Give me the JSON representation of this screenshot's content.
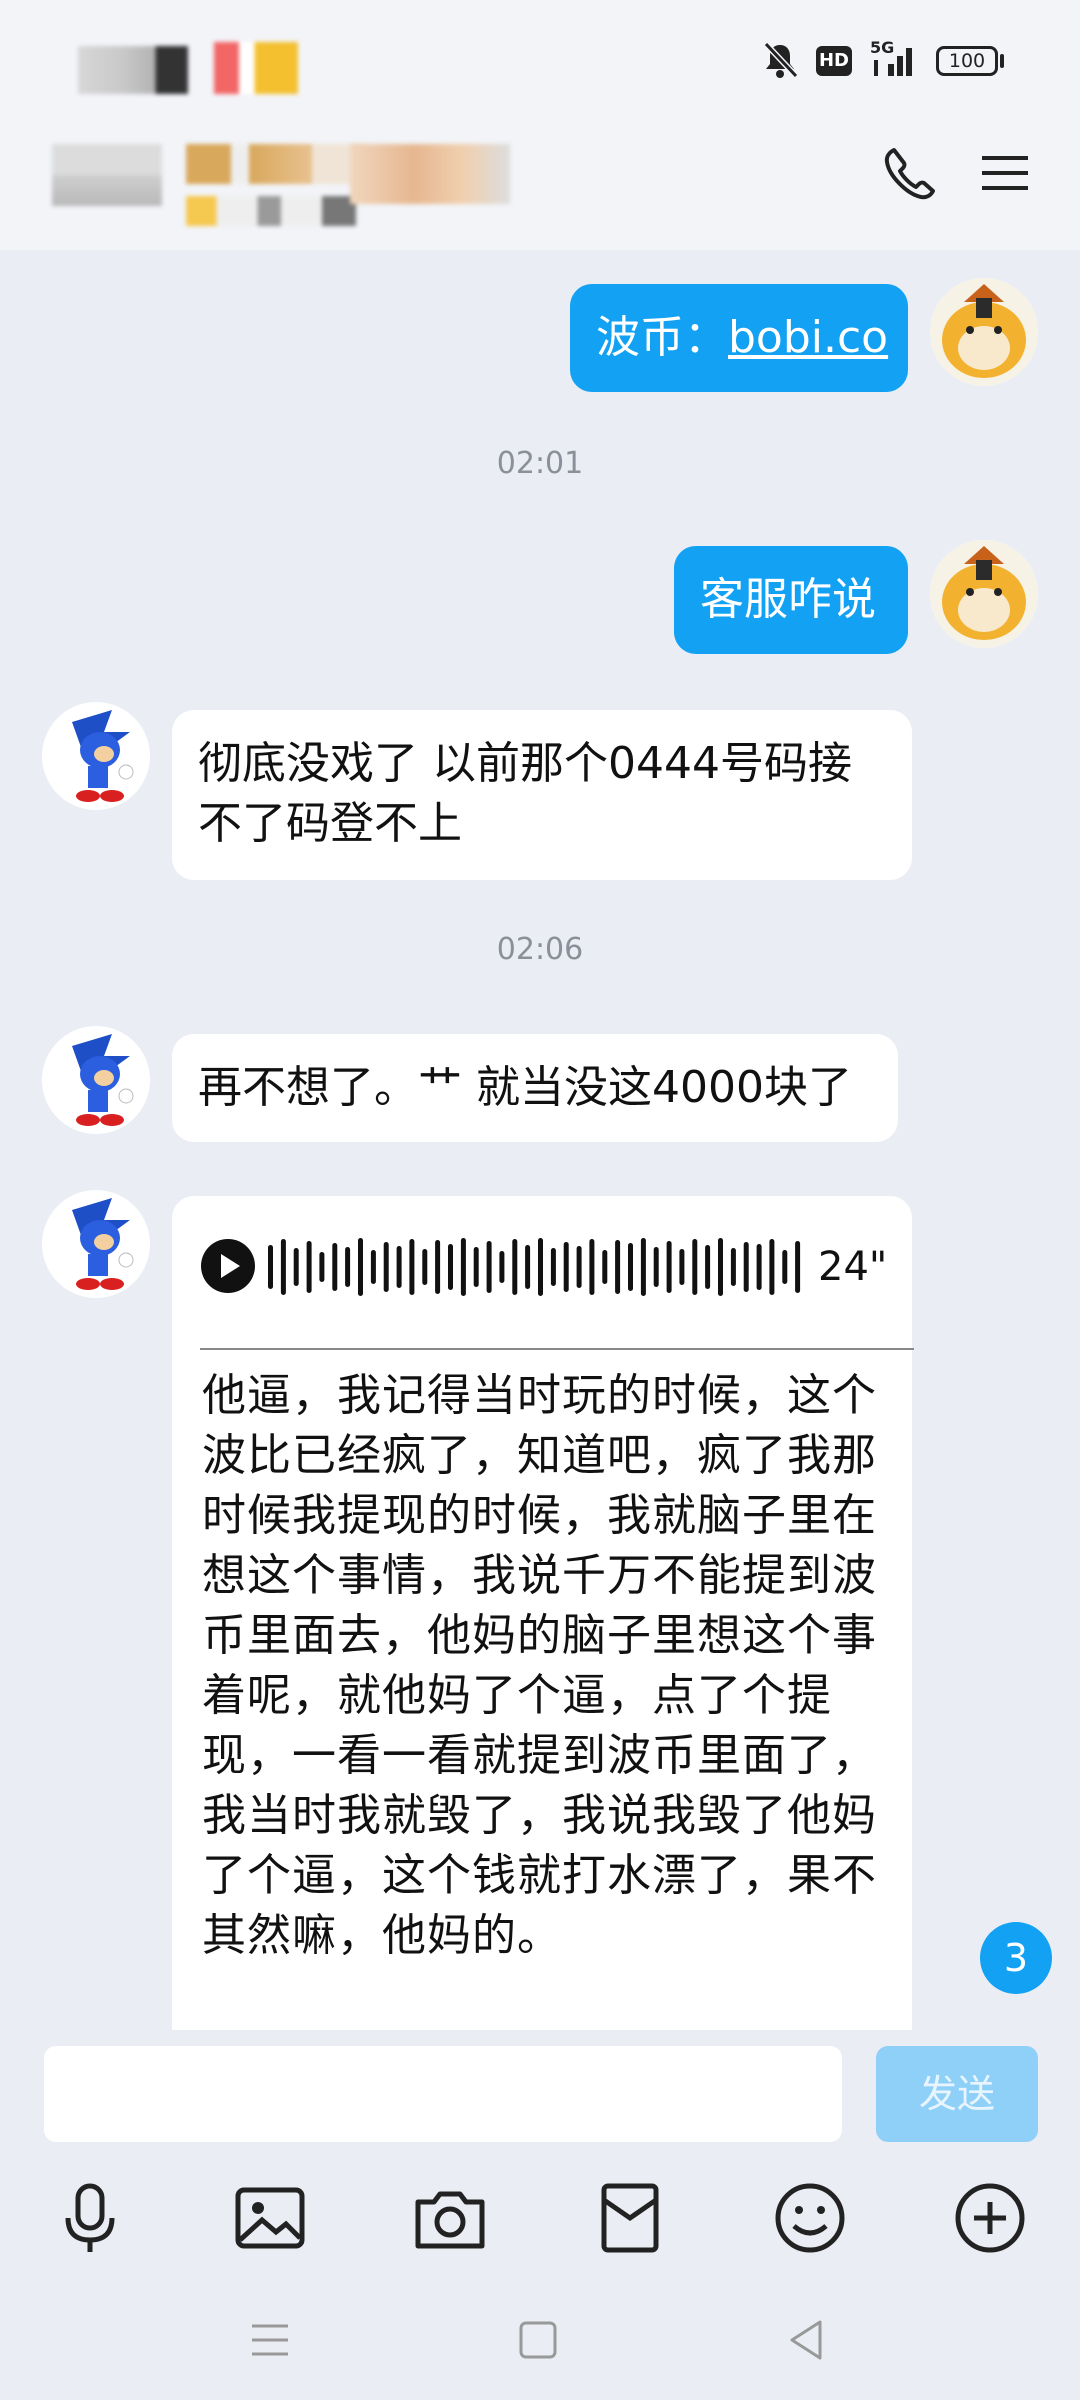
{
  "status_bar": {
    "network": "5G",
    "hd": "HD",
    "battery": "100"
  },
  "header": {
    "call_icon": "phone-icon",
    "menu_icon": "hamburger-menu-icon"
  },
  "messages": [
    {
      "from": "me",
      "prefix": "波币：",
      "link": "bobi.co"
    },
    {
      "type": "timestamp",
      "text": "02:01"
    },
    {
      "from": "me",
      "text": "客服咋说"
    },
    {
      "from": "other",
      "text": "彻底没戏了 以前那个0444号码接不了码登不上"
    },
    {
      "type": "timestamp",
      "text": "02:06"
    },
    {
      "from": "other",
      "text": "再不想了。艹 就当没这4000块了"
    },
    {
      "from": "other",
      "type": "voice",
      "duration": "24\"",
      "transcript": "他逼，我记得当时玩的时候，这个波比已经疯了，知道吧，疯了我那时候我提现的时候，我就脑子里在想这个事情，我说千万不能提到波币里面去，他妈的脑子里想这个事着呢，就他妈了个逼，点了个提现，一看一看就提到波币里面了，我当时我就毁了，我说我毁了他妈了个逼，这个钱就打水漂了，果不其然嘛，他妈的。"
    }
  ],
  "unread_badge": "3",
  "input": {
    "placeholder": "",
    "send_label": "发送"
  },
  "toolbar": [
    "microphone-icon",
    "image-icon",
    "camera-icon",
    "red-packet-icon",
    "emoji-icon",
    "plus-icon"
  ],
  "colors": {
    "accent": "#12a1f3",
    "background": "#eaedf3",
    "bubble_other": "#ffffff"
  }
}
